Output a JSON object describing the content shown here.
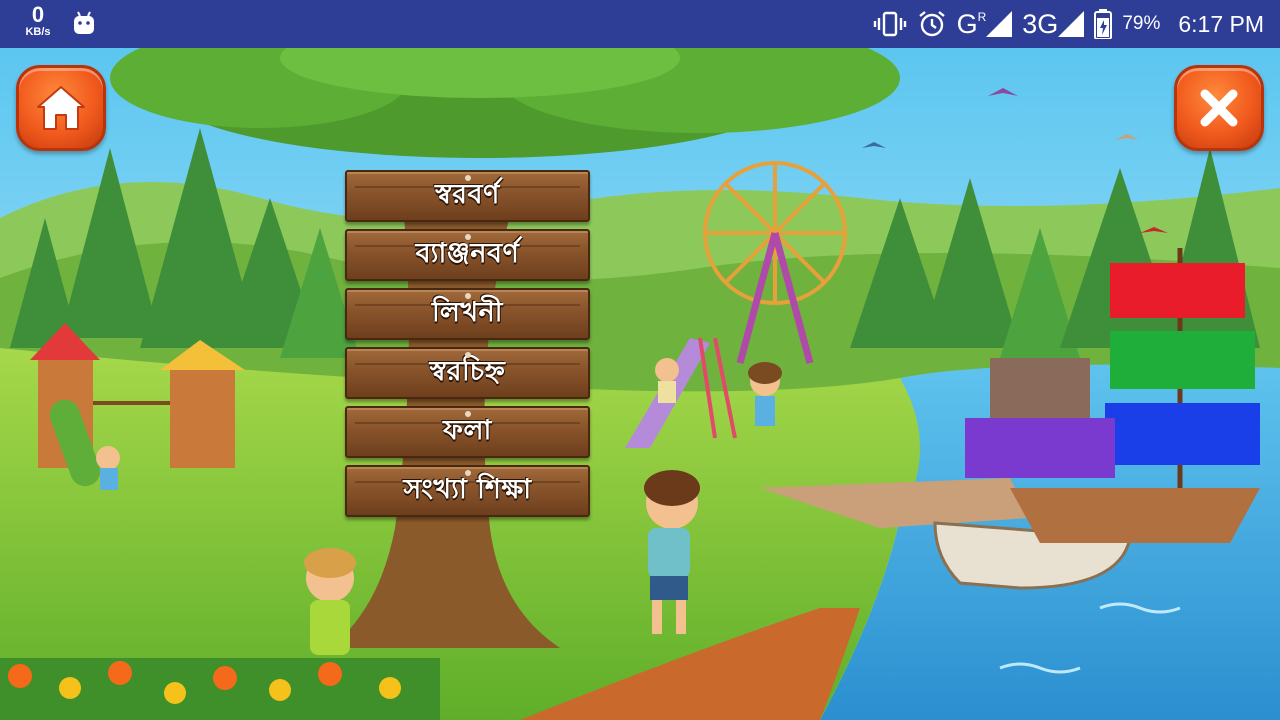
{
  "status_bar": {
    "net_speed_value": "0",
    "net_speed_unit": "KB/s",
    "signal_1_label": "G",
    "signal_1_sup": "R",
    "signal_2_label": "3G",
    "battery_percent": "79%",
    "time": "6:17 PM"
  },
  "buttons": {
    "home_icon": "home-icon",
    "close_icon": "close-icon"
  },
  "menu": {
    "items": [
      {
        "label": "স্বরবর্ণ"
      },
      {
        "label": "ব্যাঞ্জনবর্ণ"
      },
      {
        "label": "লিখনী"
      },
      {
        "label": "স্বরচিহ্ন"
      },
      {
        "label": "ফলা"
      },
      {
        "label": "সংখ্যা শিক্ষা"
      }
    ]
  },
  "colors": {
    "status_bar": "#2e3d96",
    "button_orange": "#f15a1d",
    "wood": "#8a552c",
    "sky": "#7fd0ef",
    "grass": "#7cc23a",
    "water": "#3fa9e0"
  }
}
